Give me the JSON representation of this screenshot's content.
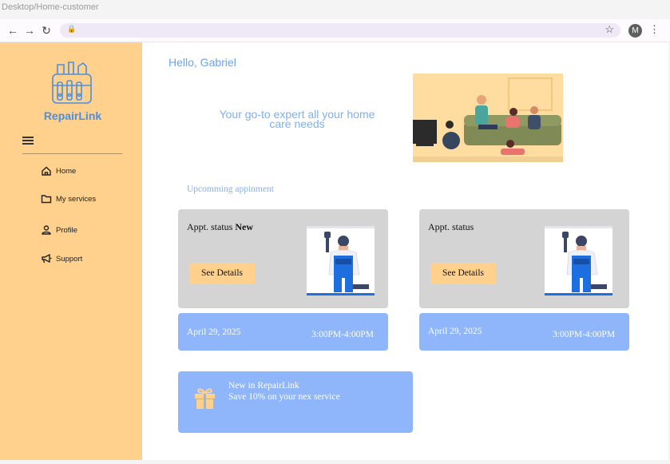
{
  "frame": {
    "title": "Desktop/Home-customer"
  },
  "browser": {
    "back": "←",
    "forward": "→",
    "reload": "↻",
    "lock": "🔒",
    "bookmark": "☆",
    "profile_initial": "M",
    "menu": "⋮"
  },
  "sidebar": {
    "brand": "RepairLink",
    "items": [
      {
        "label": "Home",
        "icon": "home-icon"
      },
      {
        "label": "My services",
        "icon": "folder-icon"
      },
      {
        "label": "Profile",
        "icon": "person-icon"
      },
      {
        "label": "Support",
        "icon": "megaphone-icon"
      }
    ]
  },
  "main": {
    "greeting": "Hello, Gabriel",
    "tagline": "Your go-to expert all your home care needs",
    "section_label": "Upcomming appinment",
    "appointments": [
      {
        "status_label": "Appt. status",
        "status_value": "New",
        "button": "See Details",
        "date": "April 29, 2025",
        "time": "3:00PM-4:00PM"
      },
      {
        "status_label": "Appt. status",
        "status_value": "",
        "button": "See Details",
        "date": "April 29, 2025",
        "time": "3:00PM-4:00PM"
      }
    ],
    "promo": {
      "title": "New in RepairLink",
      "subtitle": "Save 10% on your nex service"
    }
  },
  "colors": {
    "sidebar": "#ffd18d",
    "accent_blue": "#8fb5fa",
    "brand_blue": "#4a8fe0",
    "card_grey": "#d4d4d4"
  }
}
